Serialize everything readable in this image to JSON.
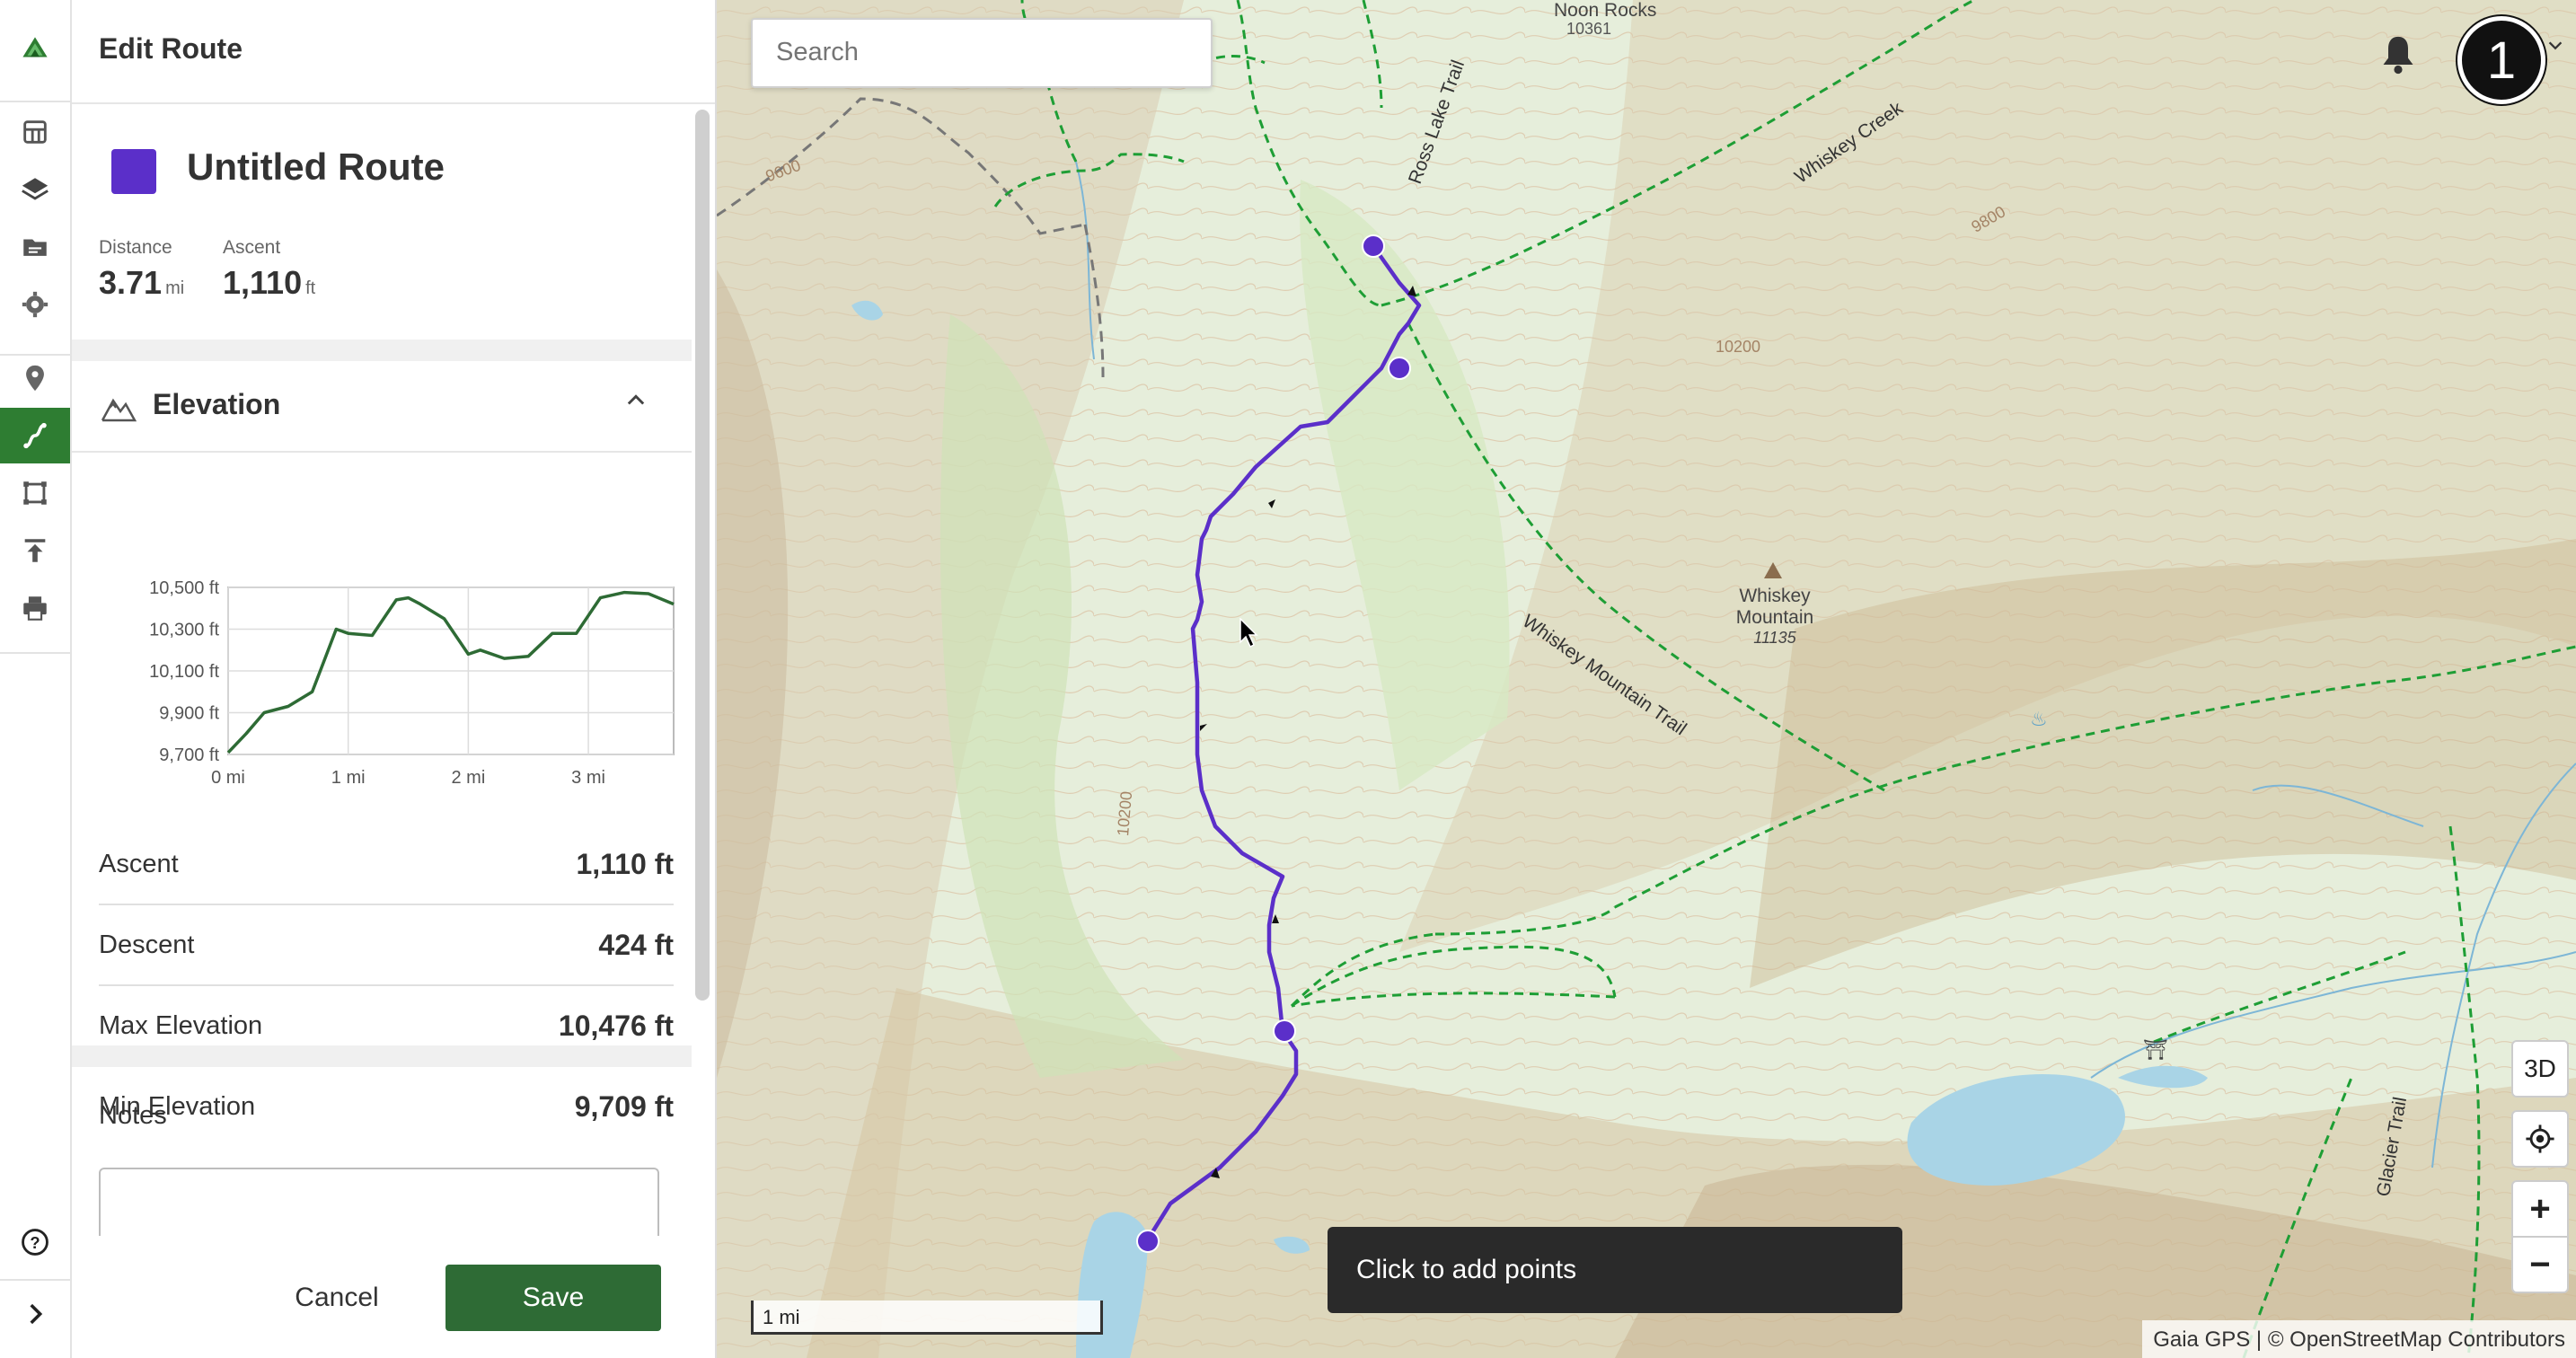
{
  "panel": {
    "title": "Edit Route",
    "route": {
      "name": "Untitled Route",
      "color": "#5b2fc9"
    },
    "stats": {
      "distance_label": "Distance",
      "distance_value": "3.71",
      "distance_unit": "mi",
      "ascent_label": "Ascent",
      "ascent_value": "1,110",
      "ascent_unit": "ft"
    },
    "elevation": {
      "title": "Elevation",
      "rows": [
        {
          "label": "Ascent",
          "value": "1,110 ft"
        },
        {
          "label": "Descent",
          "value": "424 ft"
        },
        {
          "label": "Max Elevation",
          "value": "10,476 ft"
        },
        {
          "label": "Min Elevation",
          "value": "9,709 ft"
        }
      ]
    },
    "notes_label": "Notes",
    "cancel_label": "Cancel",
    "save_label": "Save"
  },
  "chart_data": {
    "type": "line",
    "title": "",
    "xlabel": "",
    "ylabel": "",
    "x_ticks": [
      "0 mi",
      "1 mi",
      "2 mi",
      "3 mi"
    ],
    "y_ticks": [
      "10,500 ft",
      "10,300 ft",
      "10,100 ft",
      "9,900 ft",
      "9,700 ft"
    ],
    "xlim": [
      0,
      3.71
    ],
    "ylim": [
      9700,
      10500
    ],
    "series": [
      {
        "color": "#2e6b35",
        "x": [
          0,
          0.15,
          0.3,
          0.5,
          0.7,
          0.8,
          0.9,
          1.0,
          1.2,
          1.4,
          1.5,
          1.6,
          1.8,
          2.0,
          2.1,
          2.3,
          2.5,
          2.7,
          2.9,
          3.1,
          3.3,
          3.5,
          3.71
        ],
        "y": [
          9709,
          9800,
          9900,
          9930,
          10000,
          10150,
          10300,
          10280,
          10270,
          10440,
          10450,
          10420,
          10350,
          10180,
          10200,
          10160,
          10170,
          10280,
          10280,
          10450,
          10476,
          10470,
          10420
        ]
      }
    ]
  },
  "map": {
    "search_placeholder": "Search",
    "avatar_text": "1",
    "toast": "Click to add points",
    "scale_label": "1 mi",
    "attribution": "Gaia GPS | © OpenStreetMap Contributors",
    "btn_3d": "3D",
    "zoom_in": "+",
    "zoom_out": "−",
    "labels": {
      "noon_rocks": "Noon Rocks",
      "noon_rocks_elev": "10361",
      "ross_lake_trail": "Ross Lake Trail",
      "whiskey_creek": "Whiskey Creek",
      "whiskey_mountain": "Whiskey",
      "whiskey_mountain2": "Mountain",
      "whiskey_mountain_elev": "11135",
      "whiskey_mountain_trail": "Whiskey Mountain Trail",
      "glacier_trail": "Glacier Trail",
      "c10200": "10200",
      "c9800": "9800",
      "c9600": "9600",
      "c10200b": "10200"
    },
    "route_color": "#5b2fc9",
    "trail_color": "#1e9e35"
  }
}
